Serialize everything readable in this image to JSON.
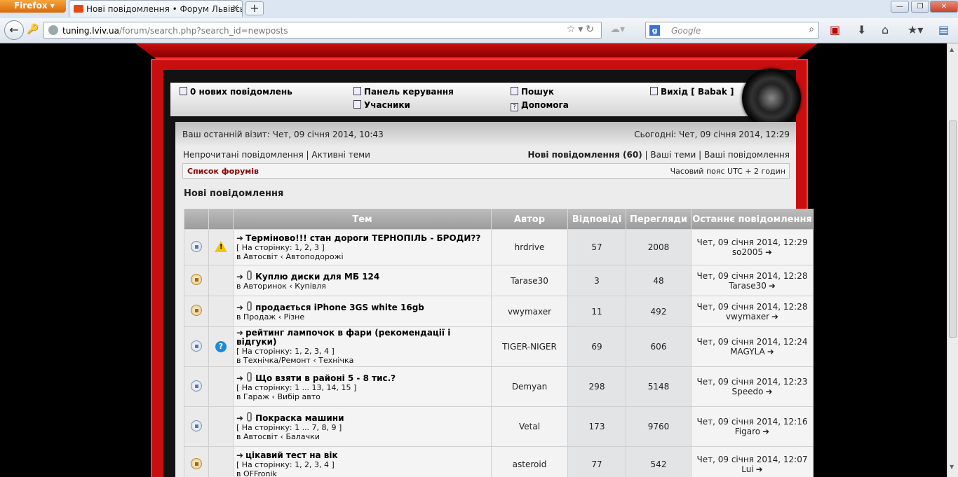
{
  "browser": {
    "menu_label": "Firefox",
    "tab_title": "Нові повідомлення • Форум Львівсько...",
    "new_tab": "+",
    "url_host": "tuning.lviv.ua",
    "url_path": "/forum/search.php?search_id=newposts",
    "search_placeholder": "Google",
    "search_engine_glyph": "g",
    "win_min": "—",
    "win_max": "❐",
    "win_close": "✕"
  },
  "menu": {
    "new_messages": "0 нових повідомлень",
    "control_panel": "Панель керування",
    "members": "Учасники",
    "search": "Пошук",
    "help": "Допомога",
    "logout": "Вихід [ Babak ]"
  },
  "info": {
    "last_visit": "Ваш останній візит: Чет, 09 січня 2014, 10:43",
    "today": "Сьогодні: Чет, 09 січня 2014, 12:29",
    "unread": "Непрочитані повідомлення",
    "active": "Активні теми",
    "new_posts": "Нові повідомлення (60)",
    "your_topics": "Ваші теми",
    "your_posts": "Ваші повідомлення",
    "separator": "|",
    "forum_list": "Список форумів",
    "timezone": "Часовий пояс UTC + 2 годин",
    "heading": "Нові повідомлення"
  },
  "table": {
    "headers": {
      "topic": "Тем",
      "author": "Автор",
      "replies": "Відповіді",
      "views": "Перегляди",
      "last_post": "Останнє повідомлення"
    },
    "rows": [
      {
        "title": "Терміново!!! стан дороги ТЕРНОПІЛЬ - БРОДИ??",
        "pages": "[ На сторінку: 1, 2, 3 ]",
        "forum": "в Автосвіт ‹ Автоподорожі",
        "author": "hrdrive",
        "replies": "57",
        "views": "2008",
        "last_date": "Чет, 09 січня 2014, 12:29",
        "last_user": "so2005"
      },
      {
        "title": "Куплю диски для МБ 124",
        "pages": "",
        "forum": "в Авторинок ‹ Купівля",
        "author": "Tarase30",
        "replies": "3",
        "views": "48",
        "last_date": "Чет, 09 січня 2014, 12:28",
        "last_user": "Tarase30"
      },
      {
        "title": "продається iPhone 3GS white 16gb",
        "pages": "",
        "forum": "в Продаж ‹ Різне",
        "author": "vwymaxer",
        "replies": "11",
        "views": "492",
        "last_date": "Чет, 09 січня 2014, 12:28",
        "last_user": "vwymaxer"
      },
      {
        "title": "рейтинг лампочок в фари (рекомендації і відгуки)",
        "pages": "[ На сторінку: 1, 2, 3, 4 ]",
        "forum": "в Технічка/Ремонт ‹ Технічка",
        "author": "TIGER-NIGER",
        "replies": "69",
        "views": "606",
        "last_date": "Чет, 09 січня 2014, 12:24",
        "last_user": "MAGYLA"
      },
      {
        "title": "Що взяти в районі 5 - 8 тис.?",
        "pages": "[ На сторінку: 1 ... 13, 14, 15 ]",
        "forum": "в Гараж ‹ Вибір авто",
        "author": "Demyan",
        "replies": "298",
        "views": "5148",
        "last_date": "Чет, 09 січня 2014, 12:23",
        "last_user": "Speedo"
      },
      {
        "title": "Покраска машини",
        "pages": "[ На сторінку: 1 ... 7, 8, 9 ]",
        "forum": "в Автосвіт ‹ Балачки",
        "author": "Vetal",
        "replies": "173",
        "views": "9760",
        "last_date": "Чет, 09 січня 2014, 12:16",
        "last_user": "Figaro"
      },
      {
        "title": "цікавий тест на вік",
        "pages": "[ На сторінку: 1, 2, 3, 4 ]",
        "forum": "в OFFronik",
        "author": "asteroid",
        "replies": "77",
        "views": "542",
        "last_date": "Чет, 09 січня 2014, 12:07",
        "last_user": "Lui"
      }
    ]
  },
  "icons": {
    "row_status": [
      "read-topic-icon",
      "hot-topic-icon",
      "hot-topic-icon",
      "read-topic-icon",
      "read-topic-icon",
      "read-topic-icon",
      "hot-topic-icon"
    ],
    "row_extra": [
      "warning-icon",
      "",
      "",
      "question-icon",
      "",
      "",
      ""
    ],
    "row_attach": [
      false,
      true,
      true,
      false,
      true,
      true,
      false
    ]
  },
  "colors": {
    "frame_red": "#c80e0e",
    "header_gray": "#9b9b9b",
    "forum_list_link": "#8b0000"
  }
}
